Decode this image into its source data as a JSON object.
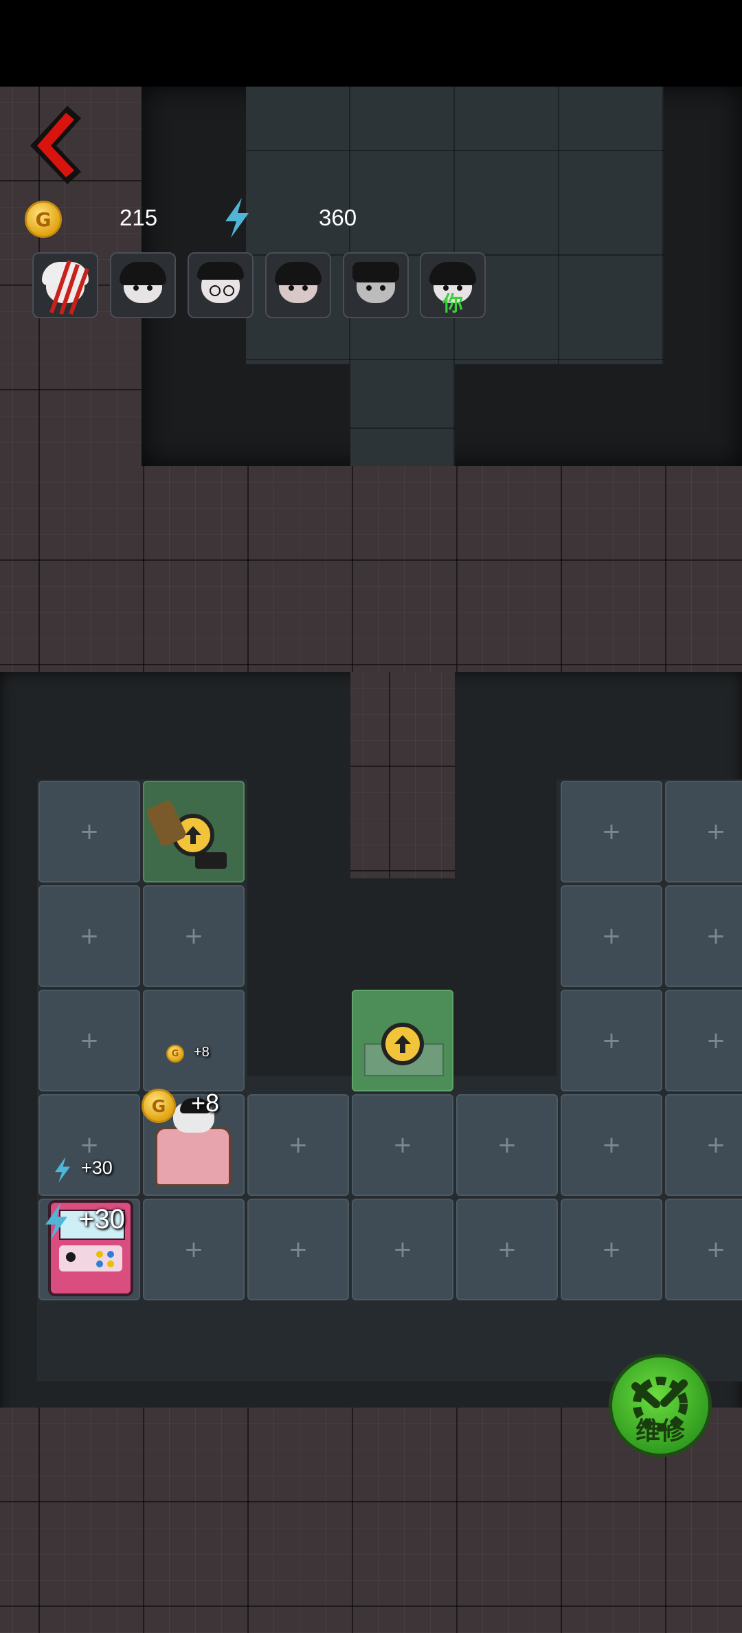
{
  "hud": {
    "coins": "215",
    "energy": "360",
    "coin_symbol": "G"
  },
  "players": [
    {
      "icon": "ghost-attacker-avatar"
    },
    {
      "icon": "student-avatar"
    },
    {
      "icon": "glasses-boy-avatar"
    },
    {
      "icon": "pigtail-girl-avatar"
    },
    {
      "icon": "messy-hair-boy-avatar"
    },
    {
      "icon": "self-avatar",
      "label": "你"
    }
  ],
  "floating": {
    "small_coin_gain": "+8",
    "bed_coin_gain": "+8",
    "small_energy_gain": "+30",
    "machine_energy_gain": "+30"
  },
  "repair_button": {
    "label": "维修"
  },
  "colors": {
    "accent_red": "#d9130e",
    "coin_gold": "#f0b21e",
    "energy_blue": "#4fb6d8",
    "repair_green": "#3fb42a",
    "self_label_green": "#3ad13a"
  }
}
